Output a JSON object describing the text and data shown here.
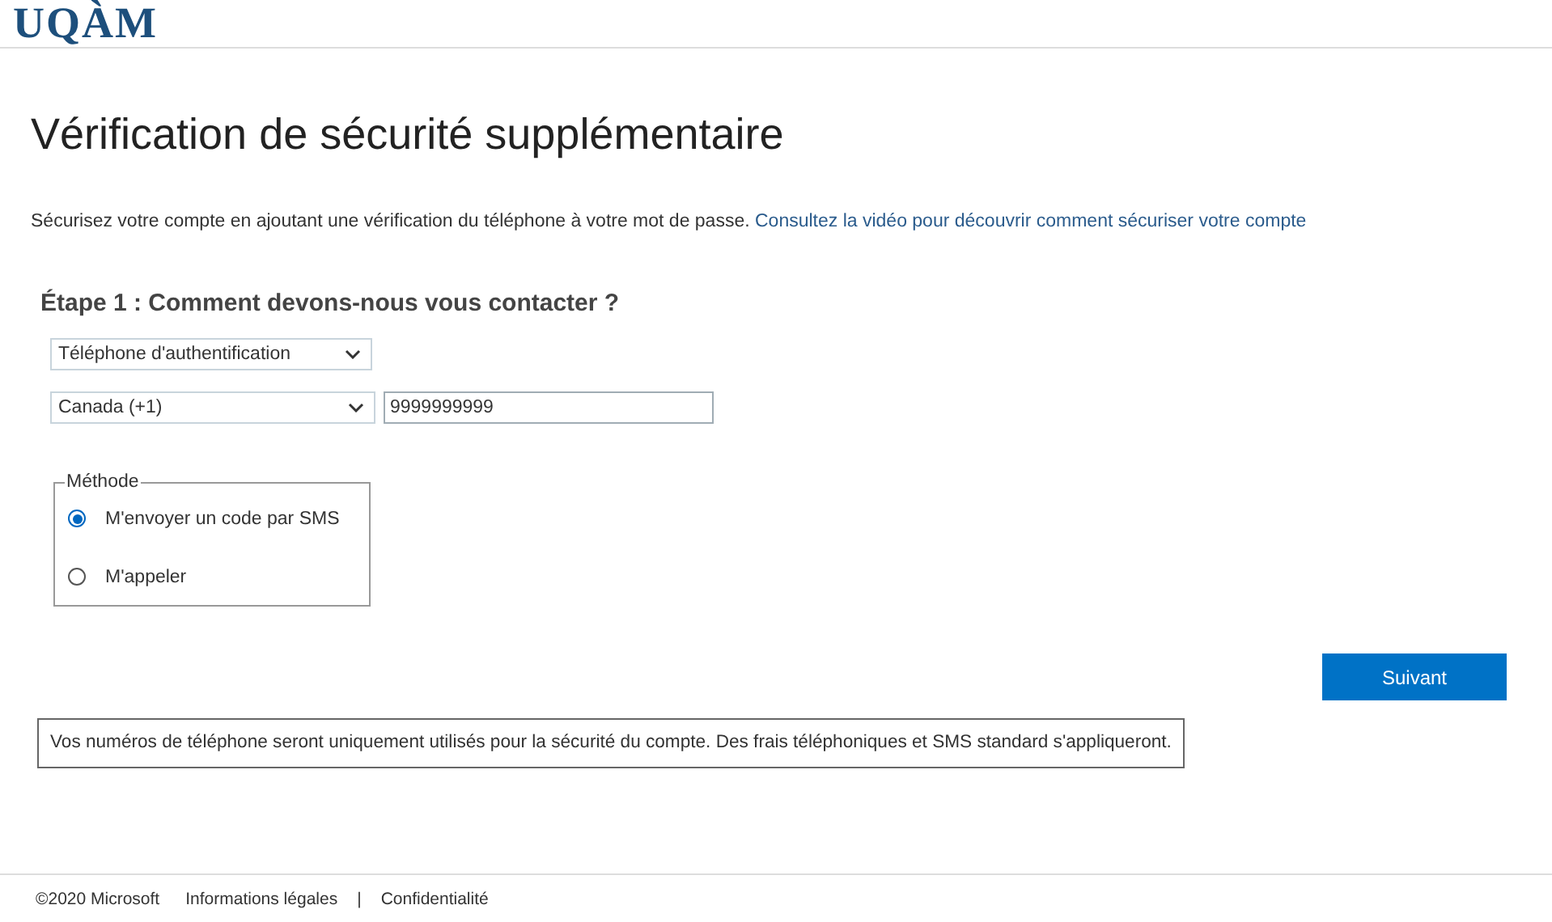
{
  "header": {
    "logo": "UQÀM"
  },
  "title": "Vérification de sécurité supplémentaire",
  "intro": {
    "text": "Sécurisez votre compte en ajoutant une vérification du téléphone à votre mot de passe.",
    "link": "Consultez la vidéo pour découvrir comment sécuriser votre compte"
  },
  "step": {
    "heading": "Étape 1 : Comment devons-nous vous contacter ?",
    "contact_method": "Téléphone d'authentification",
    "country": "Canada (+1)",
    "phone": "9999999999",
    "method": {
      "legend": "Méthode",
      "options": [
        {
          "label": "M'envoyer un code par SMS",
          "selected": true
        },
        {
          "label": "M'appeler",
          "selected": false
        }
      ]
    }
  },
  "next_button": "Suivant",
  "notice": "Vos numéros de téléphone seront uniquement utilisés pour la sécurité du compte. Des frais téléphoniques et SMS standard s'appliqueront.",
  "footer": {
    "copyright": "©2020 Microsoft",
    "links": [
      "Informations légales",
      "Confidentialité"
    ],
    "separator": "|"
  }
}
